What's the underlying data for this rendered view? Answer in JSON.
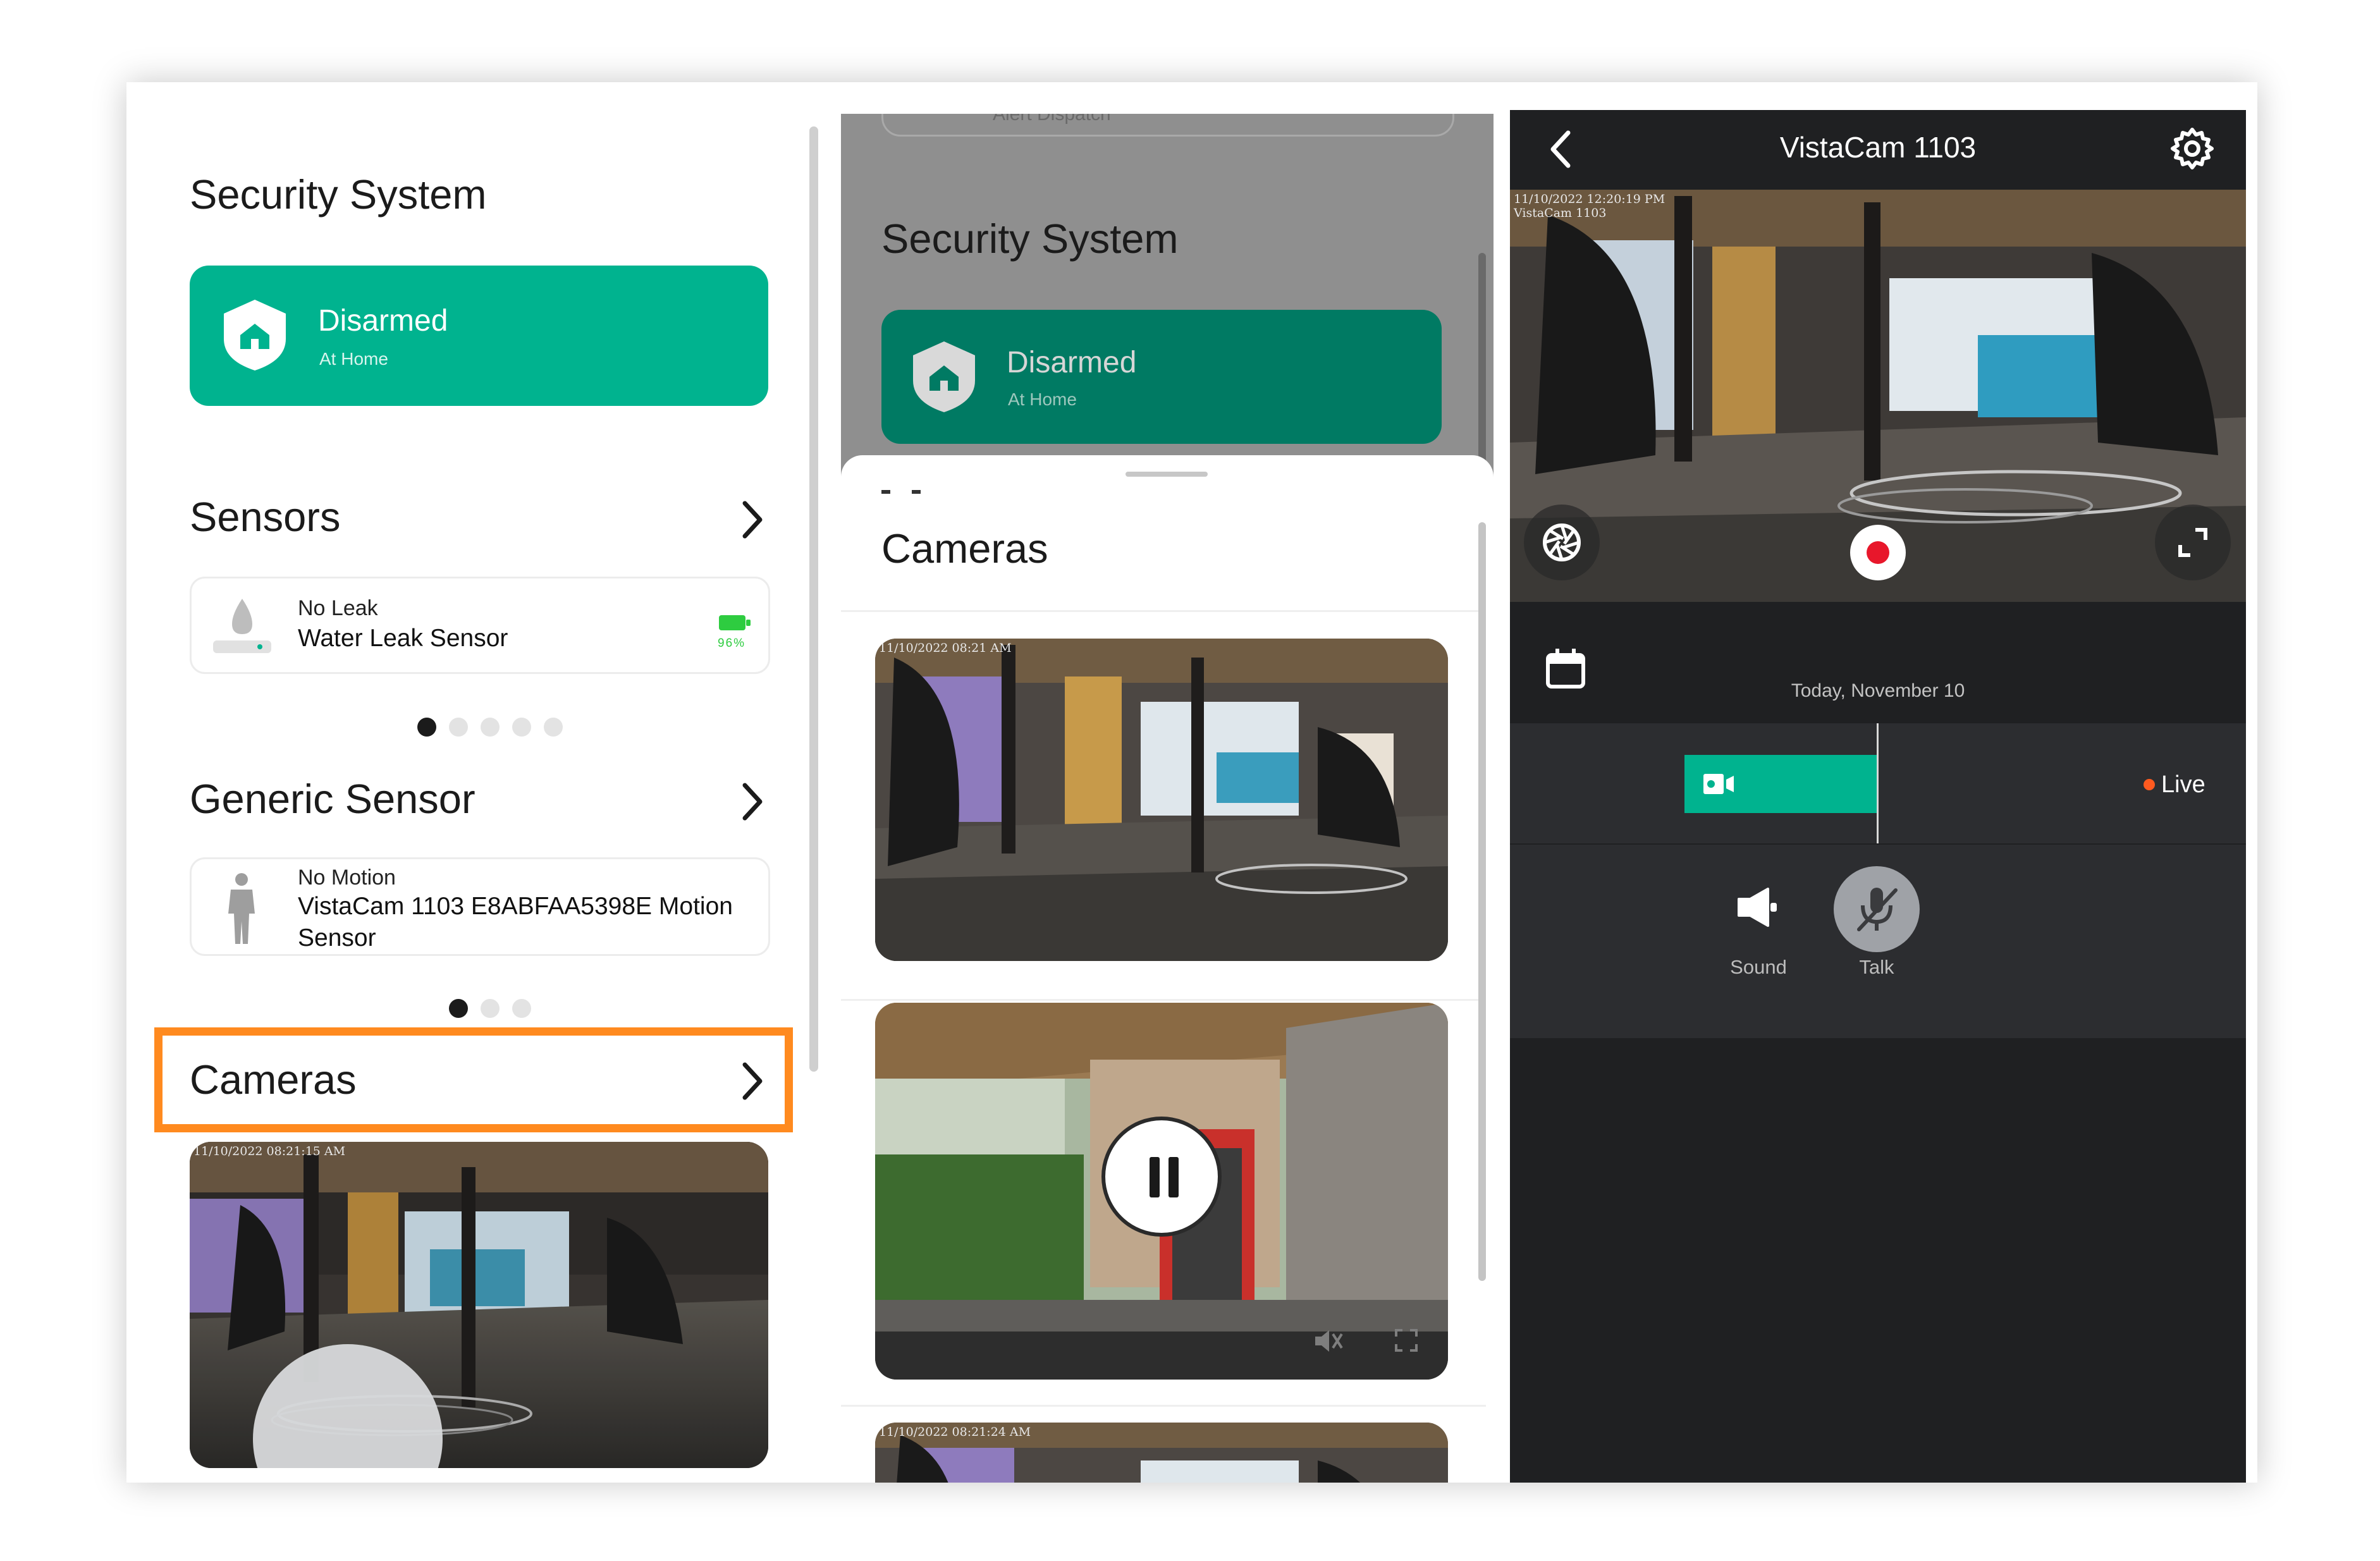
{
  "left_panel": {
    "security_title": "Security System",
    "security_status": {
      "title": "Disarmed",
      "subtitle": "At Home"
    },
    "sensors": {
      "title": "Sensors",
      "item": {
        "status": "No Leak",
        "name": "Water Leak Sensor",
        "battery": "96%"
      },
      "pager": {
        "count": 5,
        "active": 0
      }
    },
    "generic_sensor": {
      "title": "Generic Sensor",
      "item": {
        "status": "No Motion",
        "name": "VistaCam 1103 E8ABFAA5398E Motion Sensor"
      },
      "pager": {
        "count": 3,
        "active": 0
      }
    },
    "cameras": {
      "title": "Cameras",
      "thumb_timestamp": "11/10/2022 08:21:15 AM"
    }
  },
  "middle_panel": {
    "security_title": "Security System",
    "security_status": {
      "title": "Disarmed",
      "subtitle": "At Home"
    },
    "top_cut_text": "Alert Dispatch",
    "cameras_title": "Cameras",
    "thumb1_timestamp": "11/10/2022 08:21 AM",
    "thumb3_timestamp": "11/10/2022 08:21:24 AM"
  },
  "right_panel": {
    "title": "VistaCam 1103",
    "overlay_timestamp": "11/10/2022 12:20:19 PM",
    "overlay_camname": "VistaCam 1103",
    "date_label": "Today, November 10",
    "live_label": "Live",
    "sound_label": "Sound",
    "talk_label": "Talk"
  },
  "colors": {
    "accent_green": "#00b38f",
    "highlight_orange": "#ff8a1f",
    "dark_panel": "#1f2022",
    "record_red": "#e8172b",
    "live_dot": "#ff5a1f"
  }
}
